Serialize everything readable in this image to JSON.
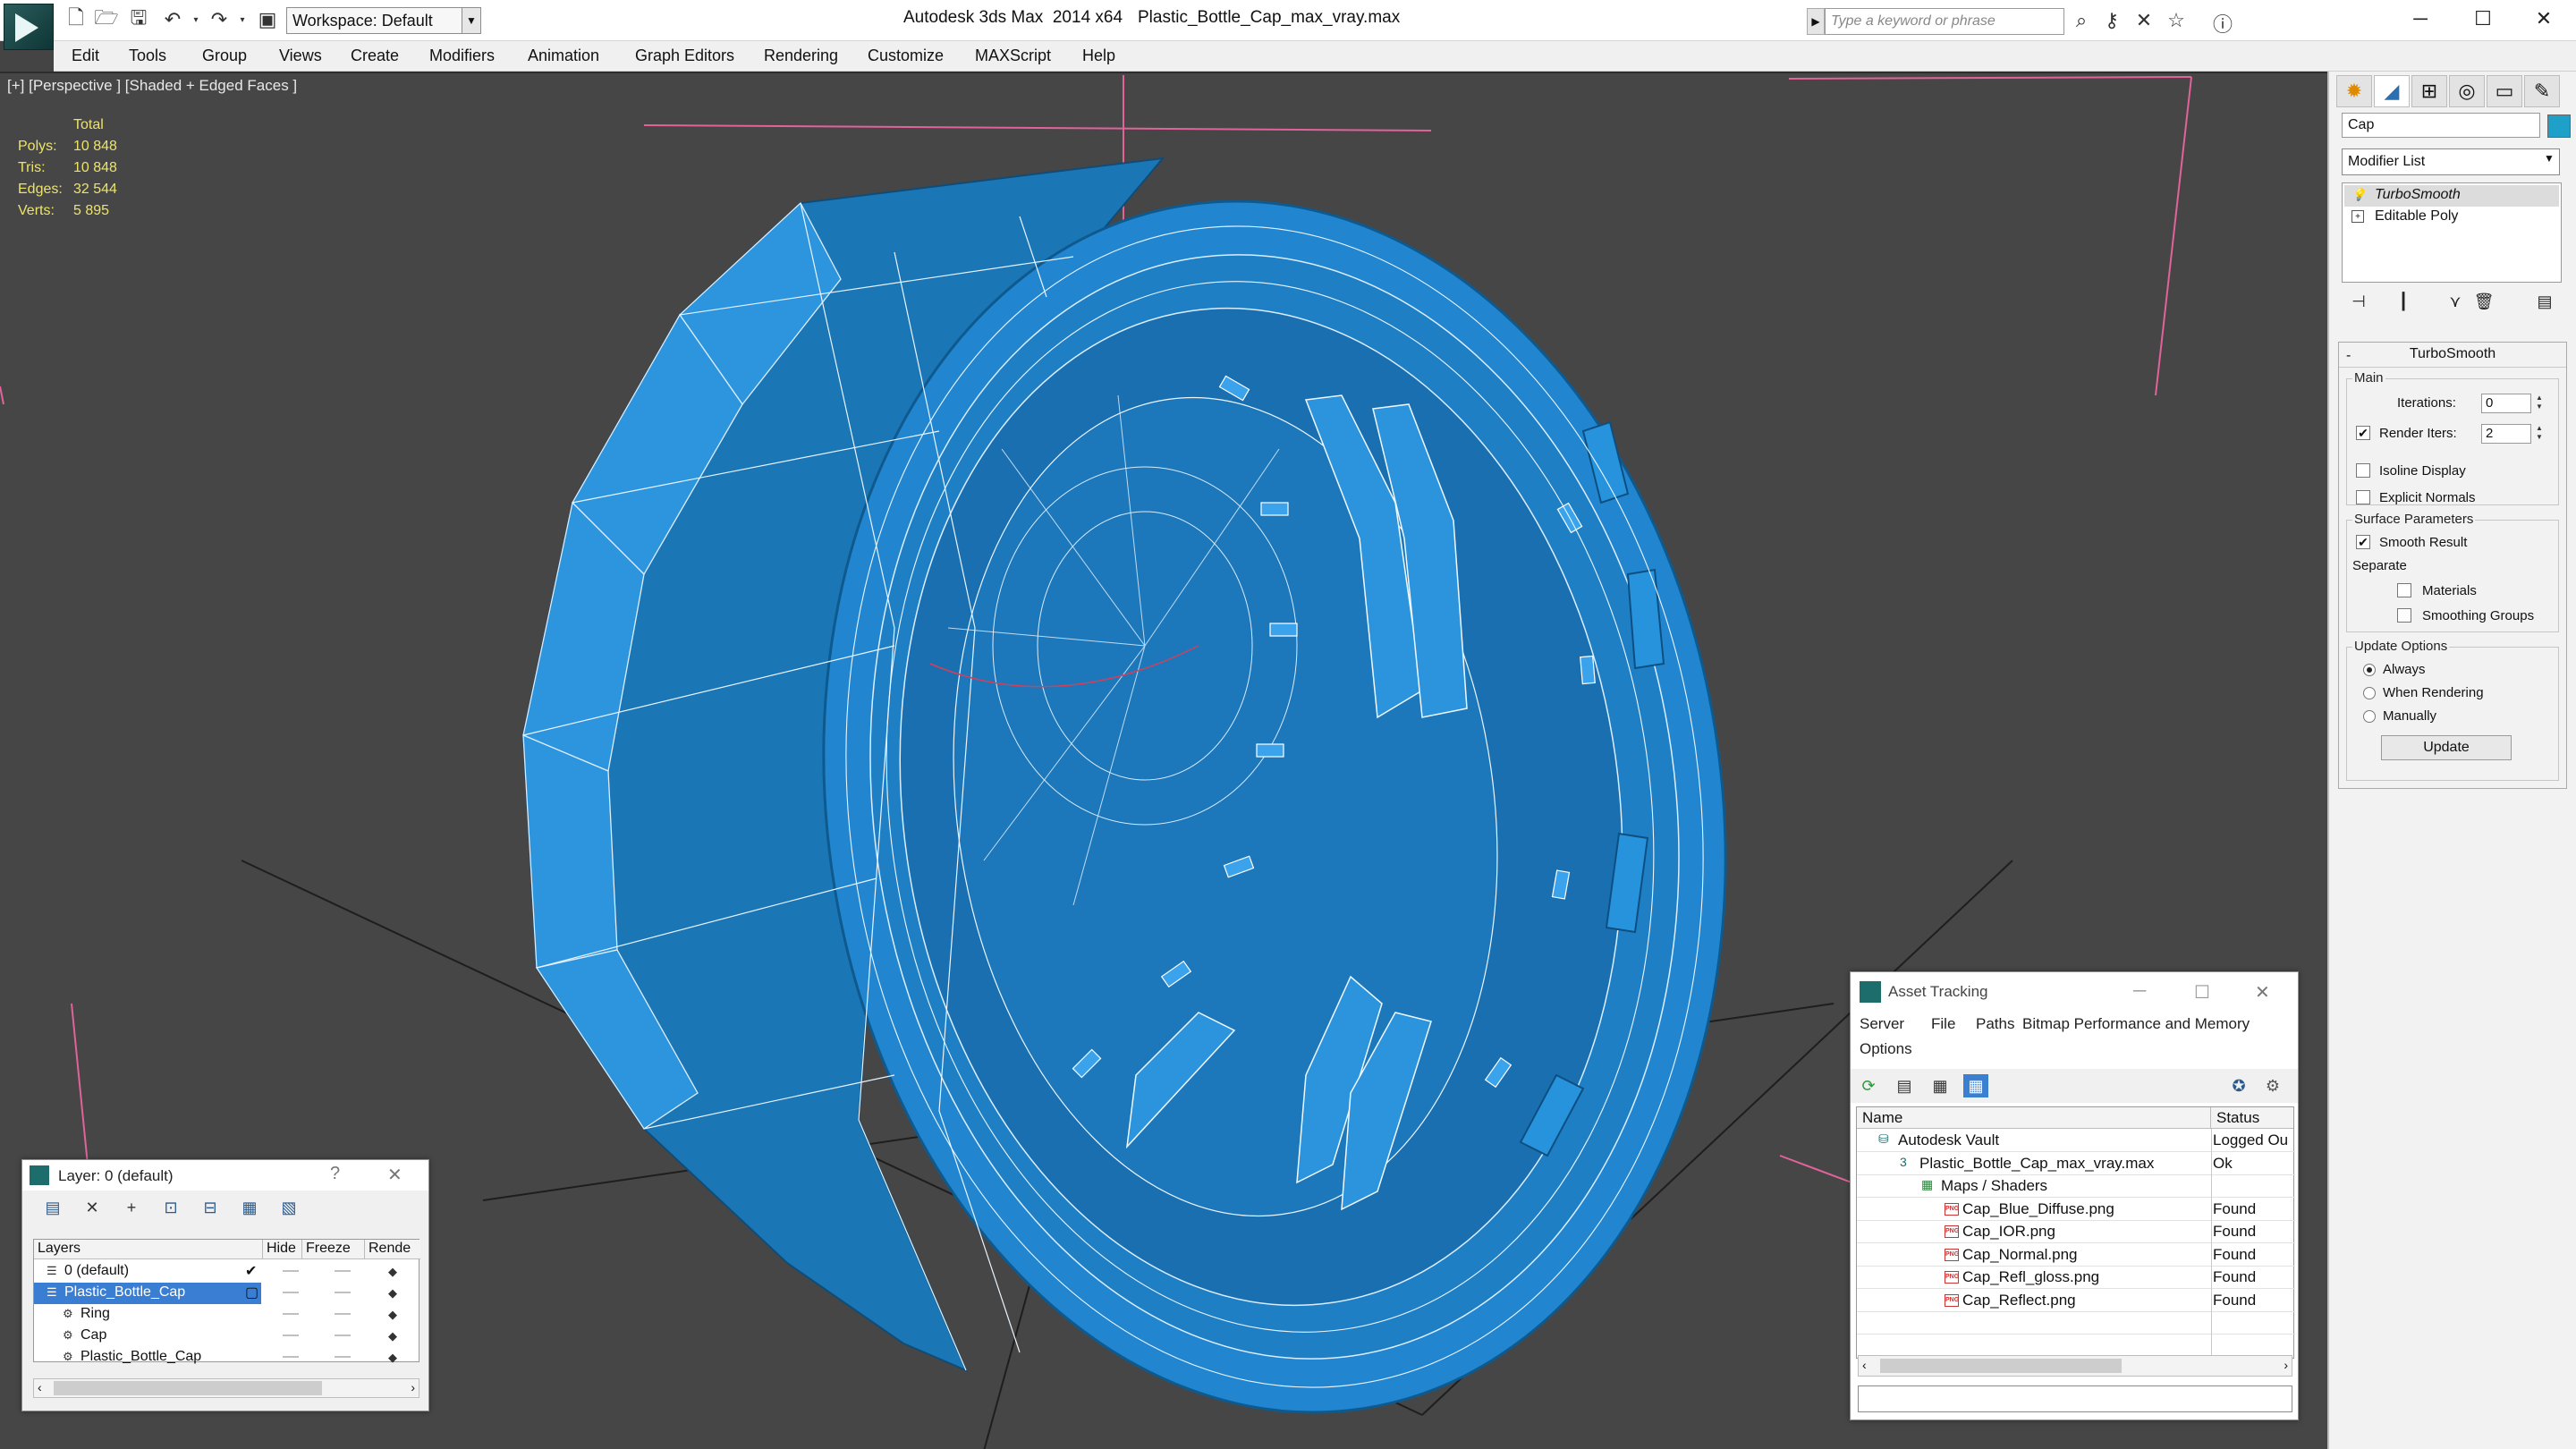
{
  "titlebar": {
    "workspace": "Workspace: Default",
    "app_title": "Autodesk 3ds Max  2014 x64",
    "file_name": "Plastic_Bottle_Cap_max_vray.max",
    "search_placeholder": "Type a keyword or phrase"
  },
  "menu": [
    "Edit",
    "Tools",
    "Group",
    "Views",
    "Create",
    "Modifiers",
    "Animation",
    "Graph Editors",
    "Rendering",
    "Customize",
    "MAXScript",
    "Help"
  ],
  "viewport": {
    "label": "[+] [Perspective ] [Shaded + Edged Faces ]",
    "object_color": "#1e83c8",
    "stats": {
      "total_label": "Total",
      "rows": [
        {
          "k": "Polys:",
          "v": "10 848"
        },
        {
          "k": "Tris:",
          "v": "10 848"
        },
        {
          "k": "Edges:",
          "v": "32 544"
        },
        {
          "k": "Verts:",
          "v": "5 895"
        }
      ]
    }
  },
  "command_panel": {
    "object_name": "Cap",
    "object_color": "#1fa0c9",
    "modifier_list": "Modifier List",
    "stack": [
      "TurboSmooth",
      "Editable Poly"
    ],
    "rollout_title": "TurboSmooth",
    "main": {
      "title": "Main",
      "iterations_label": "Iterations:",
      "iterations_value": "0",
      "render_iters_label": "Render Iters:",
      "render_iters_value": "2",
      "render_iters_checked": true,
      "isoline_label": "Isoline Display",
      "explicit_label": "Explicit Normals"
    },
    "surface": {
      "title": "Surface Parameters",
      "smooth_label": "Smooth Result",
      "separate_label": "Separate",
      "materials_label": "Materials",
      "smoothing_groups_label": "Smoothing Groups"
    },
    "update": {
      "title": "Update Options",
      "options": [
        "Always",
        "When Rendering",
        "Manually"
      ],
      "selected": "Always",
      "button": "Update"
    }
  },
  "layer_dialog": {
    "title": "Layer: 0 (default)",
    "help": "?",
    "columns": [
      "Layers",
      "Hide",
      "Freeze",
      "Rende"
    ],
    "rows": [
      {
        "name": "0 (default)",
        "active": true,
        "selected": false,
        "indent": 1
      },
      {
        "name": "Plastic_Bottle_Cap",
        "active": false,
        "selected": true,
        "indent": 1
      },
      {
        "name": "Ring",
        "active": false,
        "selected": false,
        "indent": 2
      },
      {
        "name": "Cap",
        "active": false,
        "selected": false,
        "indent": 2
      },
      {
        "name": "Plastic_Bottle_Cap",
        "active": false,
        "selected": false,
        "indent": 2
      }
    ]
  },
  "asset_dialog": {
    "title": "Asset Tracking",
    "menu": [
      "Server",
      "File",
      "Paths",
      "Bitmap Performance and Memory",
      "Options"
    ],
    "columns": [
      "Name",
      "Status"
    ],
    "rows": [
      {
        "name": "Autodesk Vault",
        "status": "Logged Ou",
        "indent": 0,
        "icon": "vault-icon"
      },
      {
        "name": "Plastic_Bottle_Cap_max_vray.max",
        "status": "Ok",
        "indent": 1,
        "icon": "max-file-icon"
      },
      {
        "name": "Maps / Shaders",
        "status": "",
        "indent": 2,
        "icon": "maps-icon"
      },
      {
        "name": "Cap_Blue_Diffuse.png",
        "status": "Found",
        "indent": 3,
        "icon": "png-icon"
      },
      {
        "name": "Cap_IOR.png",
        "status": "Found",
        "indent": 3,
        "icon": "png-icon"
      },
      {
        "name": "Cap_Normal.png",
        "status": "Found",
        "indent": 3,
        "icon": "png-icon"
      },
      {
        "name": "Cap_Refl_gloss.png",
        "status": "Found",
        "indent": 3,
        "icon": "png-icon"
      },
      {
        "name": "Cap_Reflect.png",
        "status": "Found",
        "indent": 3,
        "icon": "png-icon"
      }
    ]
  }
}
